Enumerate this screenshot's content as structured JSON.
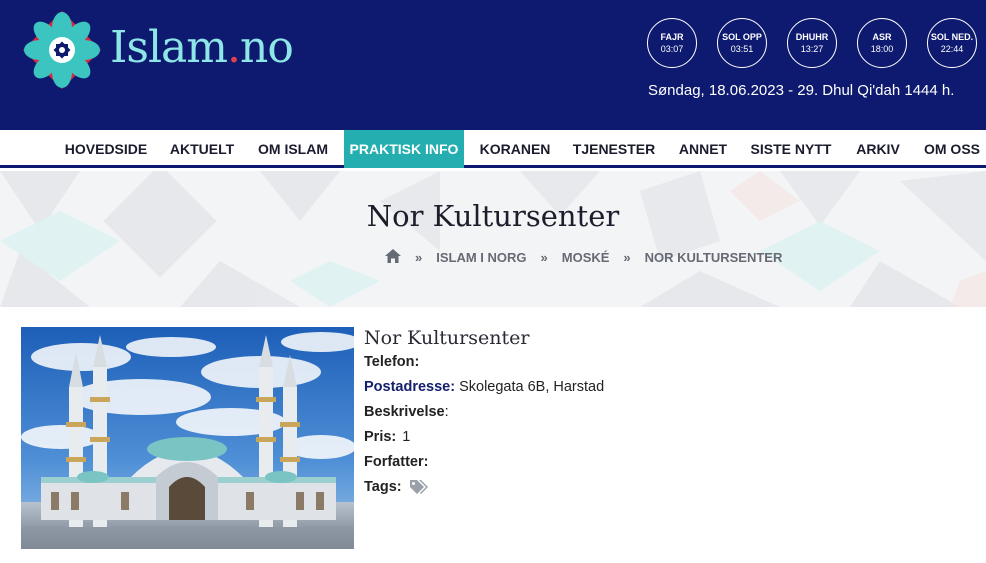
{
  "site": {
    "logo_main": "Islam",
    "logo_dot": ".",
    "logo_tld": "no"
  },
  "prayer_times": [
    {
      "name": "FAJR",
      "time": "03:07"
    },
    {
      "name": "SOL OPP",
      "time": "03:51"
    },
    {
      "name": "DHUHR",
      "time": "13:27"
    },
    {
      "name": "ASR",
      "time": "18:00"
    },
    {
      "name": "SOL NED.",
      "time": "22:44"
    }
  ],
  "date_line": "Søndag, 18.06.2023 - 29. Dhul Qi'dah 1444 h.",
  "nav": {
    "items": [
      "HOVEDSIDE",
      "AKTUELT",
      "OM ISLAM",
      "PRAKTISK INFO",
      "KORANEN",
      "TJENESTER",
      "ANNET",
      "SISTE NYTT",
      "ARKIV",
      "OM OSS"
    ],
    "active": "PRAKTISK INFO"
  },
  "page": {
    "title": "Nor Kultursenter",
    "breadcrumb": [
      "ISLAM I NORG",
      "MOSKÉ",
      "NOR KULTURSENTER"
    ]
  },
  "entry": {
    "title": "Nor Kultursenter",
    "telefon_label": "Telefon:",
    "telefon_value": "",
    "postadresse_label": "Postadresse:",
    "postadresse_value": "Skolegata 6B, Harstad",
    "beskrivelse_label": "Beskrivelse",
    "beskrivelse_colon": ":",
    "pris_label": "Pris:",
    "pris_value": "1",
    "forfatter_label": "Forfatter:",
    "forfatter_value": "",
    "tags_label": "Tags:"
  },
  "icons": {
    "home": "home-icon",
    "chevron": "double-chevron-right-icon",
    "tags": "tags-icon"
  },
  "colors": {
    "header_bg": "#0e1a6f",
    "accent": "#25aeb0",
    "logo_text": "#8ee6e6",
    "logo_dot": "#e0414a"
  }
}
